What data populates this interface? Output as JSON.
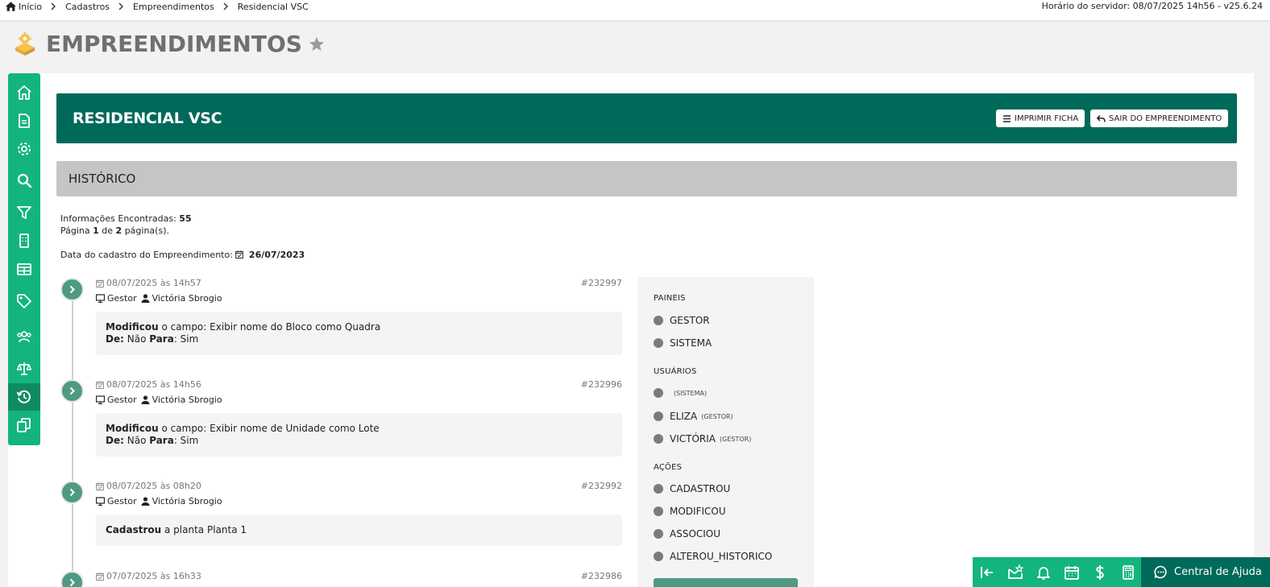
{
  "breadcrumb": {
    "items": [
      "Início",
      "Cadastros",
      "Empreendimentos",
      "Residencial VSC"
    ]
  },
  "server_time": "Horário do servidor: 08/07/2025 14h56 - v25.6.24",
  "page": {
    "title": "EMPREENDIMENTOS"
  },
  "banner": {
    "title": "RESIDENCIAL VSC",
    "print_label": "IMPRIMIR FICHA",
    "exit_label": "SAIR DO EMPREENDIMENTO"
  },
  "section": {
    "title": "HISTÓRICO"
  },
  "info": {
    "found_label": "Informações Encontradas:",
    "found_count": "55",
    "page_label": "Página",
    "page_current": "1",
    "page_of": "de",
    "page_total": "2",
    "page_suffix": "página(s).",
    "reg_label": "Data do cadastro do Empreendimento:",
    "reg_date": "26/07/2023"
  },
  "entries": [
    {
      "date": "08/07/2025 às 14h57",
      "id": "#232997",
      "panel": "Gestor",
      "user": "Victória Sbrogio",
      "action": "Modificou",
      "text": "o campo: Exibir nome do Bloco como Quadra",
      "from_label": "De:",
      "from": "Não",
      "to_label": "Para",
      "to": ": Sim"
    },
    {
      "date": "08/07/2025 às 14h56",
      "id": "#232996",
      "panel": "Gestor",
      "user": "Victória Sbrogio",
      "action": "Modificou",
      "text": "o campo: Exibir nome de Unidade como Lote",
      "from_label": "De:",
      "from": "Não",
      "to_label": "Para",
      "to": ": Sim"
    },
    {
      "date": "08/07/2025 às 08h20",
      "id": "#232992",
      "panel": "Gestor",
      "user": "Victória Sbrogio",
      "action": "Cadastrou",
      "text": "a planta Planta 1"
    },
    {
      "date": "07/07/2025 às 16h33",
      "id": "#232986"
    }
  ],
  "filters": {
    "panels_title": "PAINEIS",
    "panels": [
      "GESTOR",
      "SISTEMA"
    ],
    "users_title": "USUÁRIOS",
    "users": [
      {
        "name": "",
        "tag": "(SISTEMA)"
      },
      {
        "name": "ELIZA",
        "tag": "(GESTOR)"
      },
      {
        "name": "VICTÓRIA",
        "tag": "(GESTOR)"
      }
    ],
    "actions_title": "AÇÕES",
    "actions": [
      "CADASTROU",
      "MODIFICOU",
      "ASSOCIOU",
      "ALTEROU_HISTORICO"
    ]
  },
  "help": {
    "label": "Central de Ajuda"
  },
  "sidebar_icons": [
    "home-icon",
    "document-icon",
    "gear-icon",
    "search-icon",
    "filter-icon",
    "building-icon",
    "table-icon",
    "tag-icon",
    "users-icon",
    "scale-icon",
    "history-icon",
    "copy-icon"
  ],
  "colors": {
    "brand_dark": "#006a5a",
    "brand_green": "#14b47e",
    "dot_green": "#4e9a82",
    "section_gray": "#c5c5c5"
  }
}
